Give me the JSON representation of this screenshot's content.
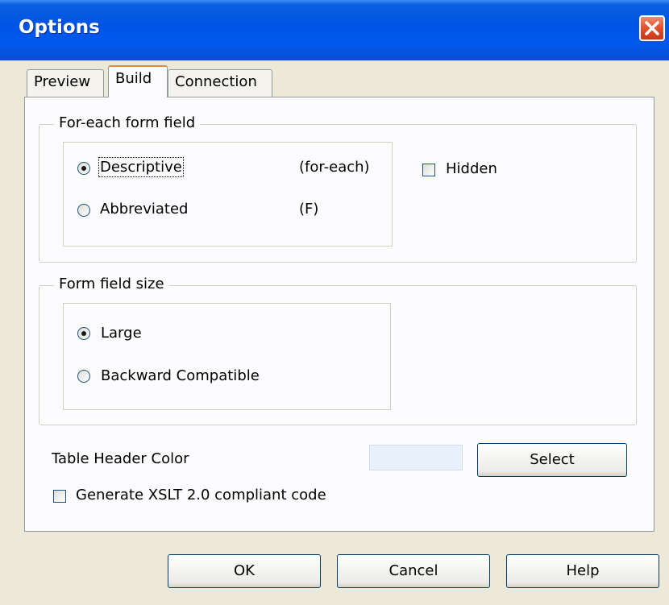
{
  "window": {
    "title": "Options",
    "accent": "#0054e3"
  },
  "tabs": [
    {
      "label": "Preview"
    },
    {
      "label": "Build"
    },
    {
      "label": "Connection"
    }
  ],
  "foreach_group": {
    "title": "For-each form field",
    "options": [
      {
        "label": "Descriptive",
        "code": "(for-each)",
        "checked": true
      },
      {
        "label": "Abbreviated",
        "code": "(F)",
        "checked": false
      }
    ],
    "hidden_label": "Hidden",
    "hidden_checked": false
  },
  "size_group": {
    "title": "Form field size",
    "options": [
      {
        "label": "Large",
        "checked": true
      },
      {
        "label": "Backward Compatible",
        "checked": false
      }
    ]
  },
  "table_header": {
    "label": "Table Header Color",
    "color": "#e6f1fc",
    "select_label": "Select"
  },
  "xslt": {
    "label": "Generate XSLT 2.0 compliant code",
    "checked": false
  },
  "buttons": {
    "ok": "OK",
    "cancel": "Cancel",
    "help": "Help"
  }
}
